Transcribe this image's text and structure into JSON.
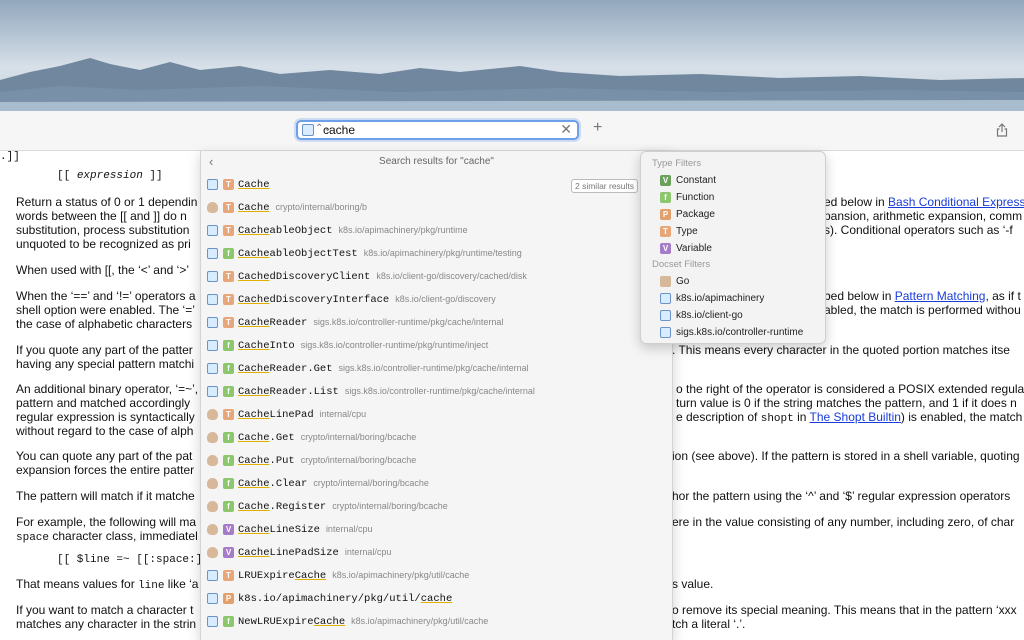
{
  "toolbar": {
    "search_value": "cache",
    "clear_glyph": "✕",
    "add_tab_glyph": "+",
    "updown_glyph": "⌃⌄"
  },
  "results": {
    "back_glyph": "‹",
    "title": "Search results for \"cache\"",
    "similar_badge": "2 similar results",
    "items": [
      {
        "docset": "k8s",
        "kind": "T",
        "pre": "",
        "match": "Cache",
        "post": "",
        "path": ""
      },
      {
        "docset": "go",
        "kind": "T",
        "pre": "",
        "match": "Cache",
        "post": "",
        "path": "crypto/internal/boring/b"
      },
      {
        "docset": "k8s",
        "kind": "T",
        "pre": "",
        "match": "Cache",
        "post": "ableObject",
        "path": "k8s.io/apimachinery/pkg/runtime"
      },
      {
        "docset": "k8s",
        "kind": "f",
        "pre": "",
        "match": "Cache",
        "post": "ableObjectTest",
        "path": "k8s.io/apimachinery/pkg/runtime/testing"
      },
      {
        "docset": "k8s",
        "kind": "T",
        "pre": "",
        "match": "Cache",
        "post": "dDiscoveryClient",
        "path": "k8s.io/client-go/discovery/cached/disk"
      },
      {
        "docset": "k8s",
        "kind": "T",
        "pre": "",
        "match": "Cache",
        "post": "dDiscoveryInterface",
        "path": "k8s.io/client-go/discovery"
      },
      {
        "docset": "k8s",
        "kind": "T",
        "pre": "",
        "match": "Cache",
        "post": "Reader",
        "path": "sigs.k8s.io/controller-runtime/pkg/cache/internal"
      },
      {
        "docset": "k8s",
        "kind": "f",
        "pre": "",
        "match": "Cache",
        "post": "Into",
        "path": "sigs.k8s.io/controller-runtime/pkg/runtime/inject"
      },
      {
        "docset": "k8s",
        "kind": "f",
        "pre": "",
        "match": "Cache",
        "post": "Reader.Get",
        "path": "sigs.k8s.io/controller-runtime/pkg/cache/internal"
      },
      {
        "docset": "k8s",
        "kind": "f",
        "pre": "",
        "match": "Cache",
        "post": "Reader.List",
        "path": "sigs.k8s.io/controller-runtime/pkg/cache/internal"
      },
      {
        "docset": "go",
        "kind": "T",
        "pre": "",
        "match": "Cache",
        "post": "LinePad",
        "path": "internal/cpu"
      },
      {
        "docset": "go",
        "kind": "f",
        "pre": "",
        "match": "Cache",
        "post": ".Get",
        "path": "crypto/internal/boring/bcache"
      },
      {
        "docset": "go",
        "kind": "f",
        "pre": "",
        "match": "Cache",
        "post": ".Put",
        "path": "crypto/internal/boring/bcache"
      },
      {
        "docset": "go",
        "kind": "f",
        "pre": "",
        "match": "Cache",
        "post": ".Clear",
        "path": "crypto/internal/boring/bcache"
      },
      {
        "docset": "go",
        "kind": "f",
        "pre": "",
        "match": "Cache",
        "post": ".Register",
        "path": "crypto/internal/boring/bcache"
      },
      {
        "docset": "go",
        "kind": "V",
        "pre": "",
        "match": "Cache",
        "post": "LineSize",
        "path": "internal/cpu"
      },
      {
        "docset": "go",
        "kind": "V",
        "pre": "",
        "match": "Cache",
        "post": "LinePadSize",
        "path": "internal/cpu"
      },
      {
        "docset": "k8s",
        "kind": "T",
        "pre": "LRUExpire",
        "match": "Cache",
        "post": "",
        "path": "k8s.io/apimachinery/pkg/util/cache"
      },
      {
        "docset": "k8s",
        "kind": "P",
        "pre": "k8s.io/apimachinery/pkg/util/",
        "match": "cache",
        "post": "",
        "path": ""
      },
      {
        "docset": "k8s",
        "kind": "f",
        "pre": "NewLRUExpire",
        "match": "Cache",
        "post": "",
        "path": "k8s.io/apimachinery/pkg/util/cache"
      }
    ]
  },
  "filters": {
    "type_header": "Type Filters",
    "types": [
      {
        "icon": "V",
        "label": "Constant",
        "color": "#6aa05c"
      },
      {
        "icon": "f",
        "label": "Function",
        "color": "#8cc66d"
      },
      {
        "icon": "P",
        "label": "Package",
        "color": "#e3a06b"
      },
      {
        "icon": "T",
        "label": "Type",
        "color": "#e8a77b"
      },
      {
        "icon": "V",
        "label": "Variable",
        "color": "#a57cc6"
      }
    ],
    "docset_header": "Docset Filters",
    "docsets": [
      {
        "icon": "go",
        "label": "Go"
      },
      {
        "icon": "k8s",
        "label": "k8s.io/apimachinery"
      },
      {
        "icon": "k8s",
        "label": "k8s.io/client-go"
      },
      {
        "icon": "k8s",
        "label": "sigs.k8s.io/controller-runtime"
      }
    ]
  },
  "doc": {
    "top_fragment": ".]]",
    "expr_pre": "[[ ",
    "expr_italic": "expression",
    "expr_post": " ]]",
    "p1_left_1": "Return a status of 0 or 1 dependin",
    "p1_left_2": "words between the [[ and ]] do n",
    "p1_left_3": "substitution, process substitution",
    "p1_left_4": "unquoted to be recognized as pri",
    "p1_right_1_pre": "ed below in ",
    "p1_right_1_link": "Bash Conditional Express",
    "p1_right_2": "pansion, arithmetic expansion, comm",
    "p1_right_3": "s). Conditional operators such as ‘-f",
    "p2_left": "When used with [[, the ‘<’ and ‘>’",
    "p3_left_1": "When the ‘==’ and ‘!=’ operators a",
    "p3_left_2": "shell option were enabled. The ‘=’",
    "p3_left_3": "the case of alphabetic characters",
    "p3_right_1_pre": "bed below in ",
    "p3_right_1_link": "Pattern Matching",
    "p3_right_1_post": ", as if t",
    "p3_right_2": "abled, the match is performed withou",
    "p4_left_1": "If you quote any part of the patter",
    "p4_left_2": "having any special pattern matchi",
    "p4_right_1": ". This means every character in the quoted portion matches itse",
    "p5_left_1": "An additional binary operator, ‘=~’,",
    "p5_left_2": "pattern and matched accordingly",
    "p5_left_3": "regular expression is syntactically",
    "p5_left_4": "without regard to the case of alph",
    "p5_right_1": "o the right of the operator is considered a POSIX extended regular",
    "p5_right_2": "turn value is 0 if the string matches the pattern, and 1 if it does n",
    "p5_right_3_pre": "e description of ",
    "p5_right_3_code": "shopt",
    "p5_right_3_mid": " in ",
    "p5_right_3_link": "The Shopt Builtin",
    "p5_right_3_post": ") is enabled, the match",
    "p6_left_1": "You can quote any part of the pat",
    "p6_left_2": "expansion forces the entire patter",
    "p6_right_1": "ion (see above). If the pattern is stored in a shell variable, quoting",
    "p7_left": "The pattern will match if it matche",
    "p7_right": "hor the pattern using the ‘^’ and ‘$’ regular expression operators",
    "p8_left_1": "For example, the following will ma",
    "p8_left_2_code": "space",
    "p8_left_2_post": " character class, immediatel",
    "p8_right": "ere in the value consisting of any number, including zero, of char",
    "code_line": "[[ $line =~ [[:space:]]*(",
    "p9_left_pre": "That means values for ",
    "p9_left_code": "line",
    "p9_left_post": " like ‘a",
    "p9_right": "s value.",
    "p10_left_1": "If you want to match a character t",
    "p10_left_2": "matches any character in the strin",
    "p10_right_1": "o remove its special meaning. This means that in the pattern ‘xxx",
    "p10_right_2": "tch a literal ‘.’."
  }
}
